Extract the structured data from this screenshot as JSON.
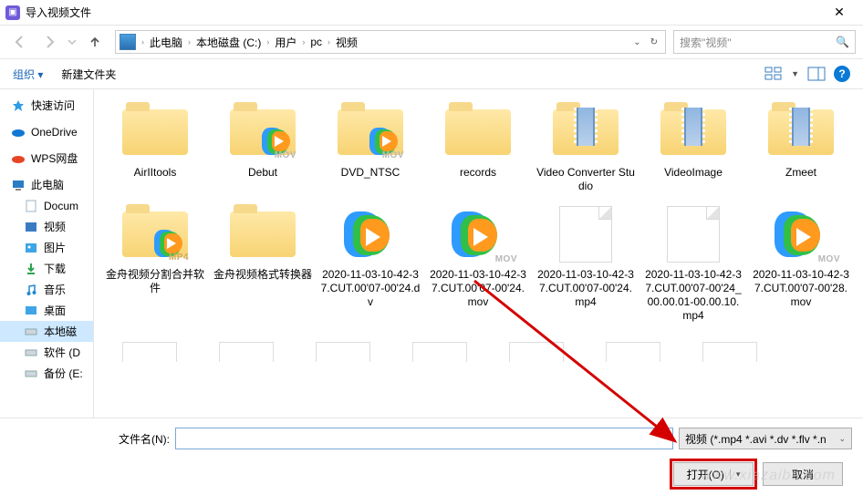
{
  "window": {
    "title": "导入视频文件"
  },
  "breadcrumbs": {
    "root": "此电脑",
    "c": "本地磁盘 (C:)",
    "user": "用户",
    "pc": "pc",
    "videos": "视频"
  },
  "search": {
    "placeholder": "搜索\"视频\""
  },
  "toolbar": {
    "organize": "组织 ▾",
    "newfolder": "新建文件夹"
  },
  "sidebar": {
    "quick": "快速访问",
    "onedrive": "OneDrive",
    "wps": "WPS网盘",
    "thispc": "此电脑",
    "docs": "Docum",
    "videos": "视频",
    "pics": "图片",
    "downloads": "下载",
    "music": "音乐",
    "desktop": "桌面",
    "localdisk": "本地磁",
    "soft_d": "软件 (D",
    "backup_e": "备份 (E:"
  },
  "files": {
    "f0": "AirIItools",
    "f1": "Debut",
    "f2": "DVD_NTSC",
    "f3": "records",
    "f4": "Video Converter Studio",
    "f5": "VideoImage",
    "f6": "Zmeet",
    "f7": "金舟视频分割合并软件",
    "f8": "金舟视频格式转换器",
    "f9": "2020-11-03-10-42-37.CUT.00'07-00'24.dv",
    "f10": "2020-11-03-10-42-37.CUT.00'07-00'24.mov",
    "f11": "2020-11-03-10-42-37.CUT.00'07-00'24.mp4",
    "f12": "2020-11-03-10-42-37.CUT.00'07-00'24_00.00.01-00.00.10.mp4",
    "f13": "2020-11-03-10-42-37.CUT.00'07-00'28.mov"
  },
  "filename": {
    "label": "文件名(N):",
    "value": ""
  },
  "filter": {
    "text": "视频 (*.mp4 *.avi *.dv *.flv *.n"
  },
  "buttons": {
    "open": "打开(O)",
    "cancel": "取消"
  },
  "watermark": "www.xiazaiba.com"
}
